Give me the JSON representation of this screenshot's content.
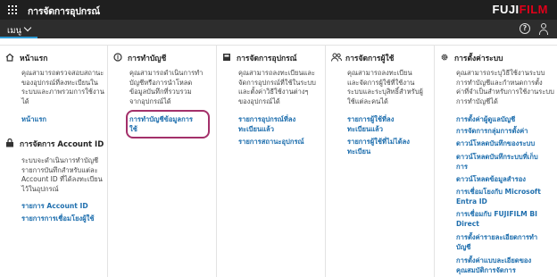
{
  "topbar": {
    "app_title": "การจัดการอุปกรณ์",
    "logo_prefix": "FUJI",
    "logo_suffix": "FILM"
  },
  "subbar": {
    "menu_label": "เมนู",
    "help_glyph": "?"
  },
  "columns": [
    {
      "sections": [
        {
          "title": "หน้าแรก",
          "icon": "home-icon",
          "description": [
            "คุณสามารถตรวจสอบสถานะ",
            "ของอุปกรณ์ที่ลงทะเบียนใน",
            "ระบบและภาพรวมการใช้งาน",
            "ได้"
          ],
          "links": [
            "หน้าแรก"
          ]
        },
        {
          "title": "การจัดการ Account ID",
          "icon": "account-id-icon",
          "description": [
            "ระบบจะดำเนินการทำบัญชี",
            "รายการบันทึกสำหรับแต่ละ",
            "Account ID ที่ได้ลงทะเบียน",
            "ไว้ในอุปกรณ์"
          ],
          "links": [
            "รายการ Account ID",
            "รายการการเชื่อมโยงผู้ใช้"
          ]
        }
      ]
    },
    {
      "sections": [
        {
          "title": "การทำบัญชี",
          "icon": "accounting-icon",
          "description": [
            "คุณสามารถดำเนินการทำ",
            "บัญชีหรือการนำโหลด",
            "ข้อมูลบันทึกที่รวบรวม",
            "จากอุปกรณ์ได้"
          ],
          "links": [
            "การทำบัญชีข้อมูลการ",
            "ใช้"
          ]
        }
      ]
    },
    {
      "sections": [
        {
          "title": "การจัดการอุปกรณ์",
          "icon": "device-icon",
          "description": [
            "คุณสามารถลงทะเบียนและ",
            "จัดการอุปกรณ์ที่ใช้ในระบบ",
            "และตั้งค่าวิธีใช้งานต่างๆ",
            "ของอุปกรณ์ได้"
          ],
          "links": [
            "รายการอุปกรณ์ที่ลง",
            "ทะเบียนแล้ว",
            "รายการสถานะอุปกรณ์"
          ]
        }
      ]
    },
    {
      "sections": [
        {
          "title": "การจัดการผู้ใช้",
          "icon": "users-icon",
          "description": [
            "คุณสามารถลงทะเบียน",
            "และจัดการผู้ใช้ที่ใช้งาน",
            "ระบบและระบุสิทธิ์สำหรับผู้",
            "ใช้แต่ละคนได้"
          ],
          "links": [
            "รายการผู้ใช้ที่ลง",
            "ทะเบียนแล้ว",
            "รายการผู้ใช้ที่ไม่ได้ลง",
            "ทะเบียน"
          ]
        }
      ]
    },
    {
      "sections": [
        {
          "title": "การตั้งค่าระบบ",
          "icon": "gear-icon",
          "description": [
            "คุณสามารถระบุวิธีใช้งานระบบ",
            "การทำบัญชีและกำหนดการตั้ง",
            "ค่าที่จำเป็นสำหรับการใช้งานระบบ",
            "การทำบัญชีได้"
          ],
          "links": [
            "การตั้งค่าผู้ดูแลบัญชี",
            "การจัดการกลุ่มการตั้งค่า",
            "ดาวน์โหลดบันทึกของระบบ",
            "ดาวน์โหลดบันทึกระบบที่เก็บ",
            "การ",
            "ดาวน์โหลดข้อมูลสำรอง",
            "การเชื่อมโยงกับ Microsoft",
            "Entra ID",
            "การเชื่อมกับ FUJIFILM BI",
            "Direct",
            "การตั้งค่ารายละเอียดการทำ",
            "บัญชี",
            "การตั้งค่าแบบละเอียดของ",
            "คุณสมบัติการจัดการ"
          ]
        }
      ]
    }
  ]
}
